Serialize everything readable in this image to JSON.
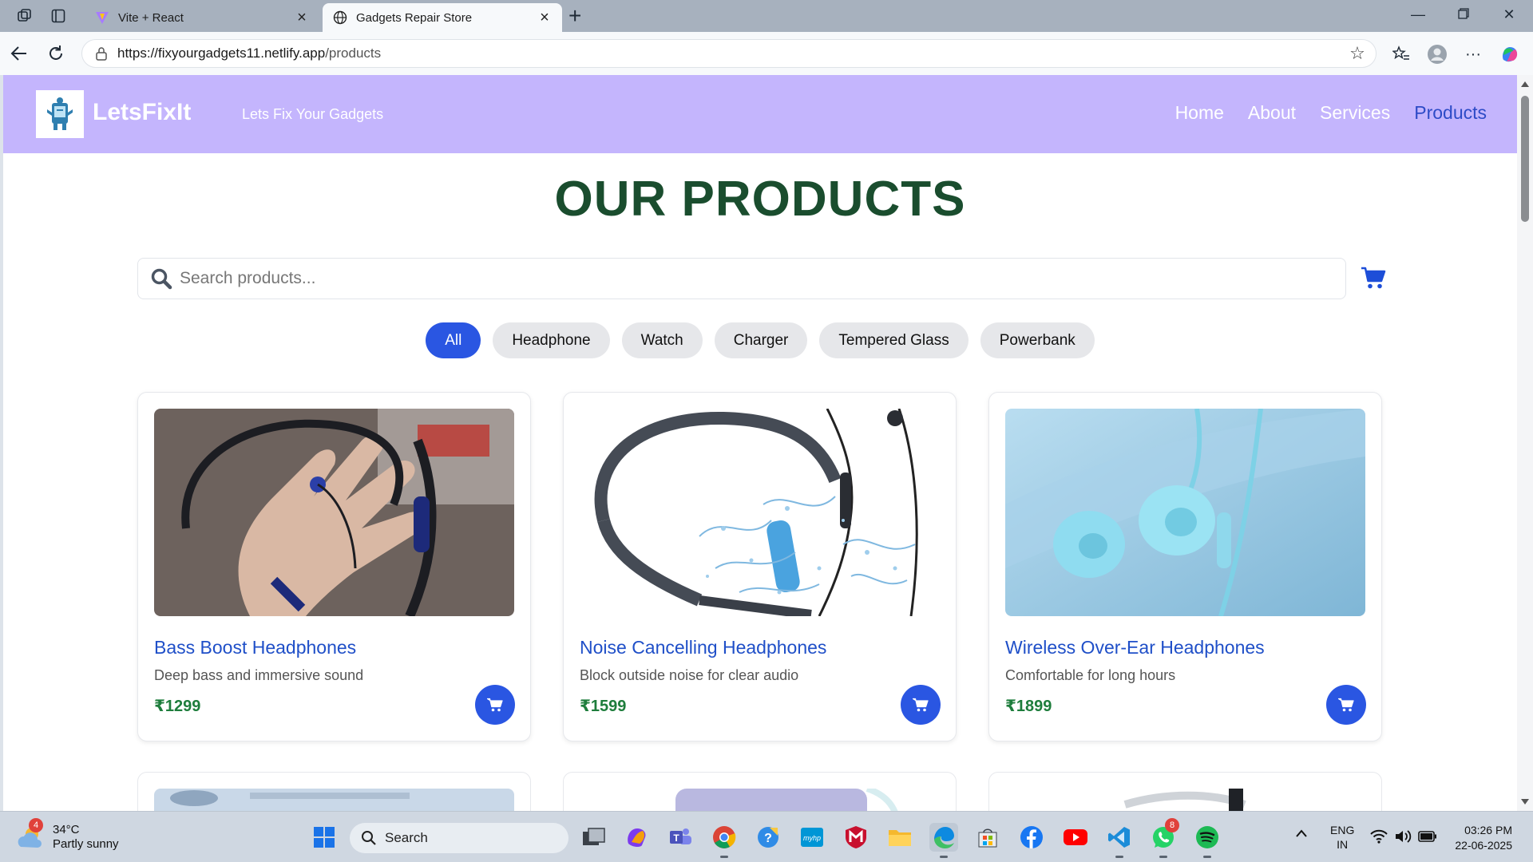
{
  "browser": {
    "tabs": [
      {
        "title": "Vite + React",
        "active": false
      },
      {
        "title": "Gadgets Repair Store",
        "active": true
      }
    ],
    "url_host": "https://fixyourgadgets11.netlify.app",
    "url_path": "/products"
  },
  "site": {
    "brand": "LetsFixIt",
    "tagline": "Lets Fix Your Gadgets",
    "nav": [
      {
        "label": "Home",
        "active": false
      },
      {
        "label": "About",
        "active": false
      },
      {
        "label": "Services",
        "active": false
      },
      {
        "label": "Products",
        "active": true
      }
    ],
    "accent": "#c4b5fd",
    "active_nav_color": "#2d4bc7"
  },
  "products_page": {
    "title": "OUR PRODUCTS",
    "search_placeholder": "Search products...",
    "filters": [
      {
        "label": "All",
        "active": true
      },
      {
        "label": "Headphone",
        "active": false
      },
      {
        "label": "Watch",
        "active": false
      },
      {
        "label": "Charger",
        "active": false
      },
      {
        "label": "Tempered Glass",
        "active": false
      },
      {
        "label": "Powerbank",
        "active": false
      }
    ],
    "products": [
      {
        "name": "Bass Boost Headphones",
        "description": "Deep bass and immersive sound",
        "price": "₹1299"
      },
      {
        "name": "Noise Cancelling Headphones",
        "description": "Block outside noise for clear audio",
        "price": "₹1599"
      },
      {
        "name": "Wireless Over-Ear Headphones",
        "description": "Comfortable for long hours",
        "price": "₹1899"
      }
    ]
  },
  "taskbar": {
    "weather_badge": "4",
    "temperature": "34°C",
    "condition": "Partly sunny",
    "search_label": "Search",
    "whatsapp_badge": "8",
    "lang_line1": "ENG",
    "lang_line2": "IN",
    "time": "03:26 PM",
    "date": "22-06-2025"
  }
}
